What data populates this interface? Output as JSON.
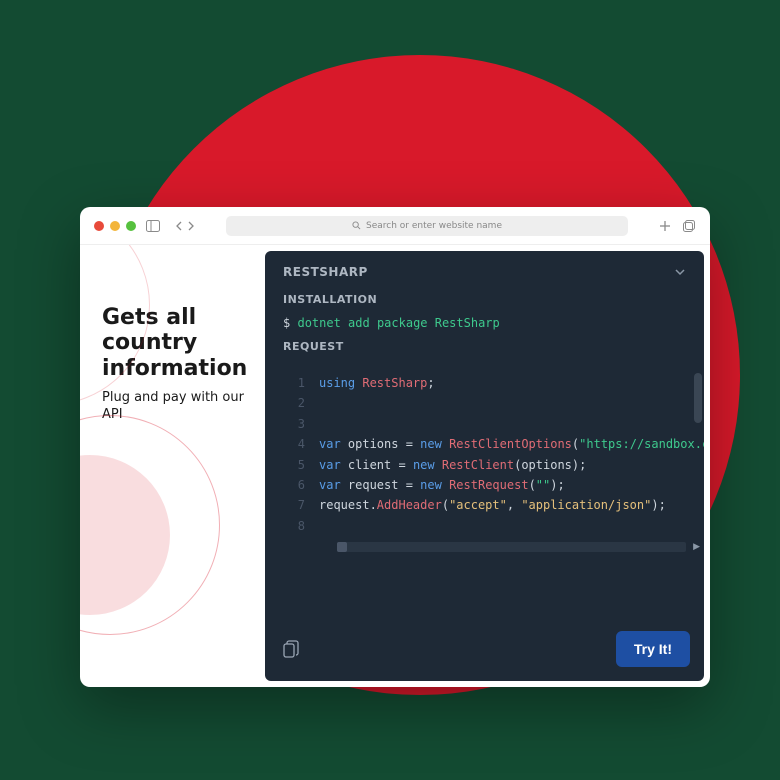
{
  "browser": {
    "urlbar_placeholder": "Search or enter website name"
  },
  "hero": {
    "title": "Gets all country information",
    "subtitle": "Plug and pay with our API"
  },
  "panel": {
    "title": "RESTSHARP",
    "installation_label": "INSTALLATION",
    "install_prompt": "$",
    "install_cmd": "dotnet add package RestSharp",
    "request_label": "REQUEST",
    "try_button": "Try It!"
  },
  "code": {
    "l1": {
      "num": "1",
      "kw": "using",
      "type": " RestSharp",
      "pn": ";"
    },
    "l2": {
      "num": "2"
    },
    "l3": {
      "num": "3"
    },
    "l4": {
      "num": "4",
      "kw": "var",
      "pn1": " options = ",
      "kw2": "new",
      "type": " RestClientOptions",
      "pn2": "(",
      "str": "\"https://sandbox.caxt"
    },
    "l5": {
      "num": "5",
      "kw": "var",
      "pn1": " client = ",
      "kw2": "new",
      "type": " RestClient",
      "pn2": "(options);"
    },
    "l6": {
      "num": "6",
      "kw": "var",
      "pn1": " request = ",
      "kw2": "new",
      "type": " RestRequest",
      "pn2": "(",
      "str": "\"\"",
      "pn3": ");"
    },
    "l7": {
      "num": "7",
      "pn1": "request.",
      "fn": "AddHeader",
      "pn2": "(",
      "str1": "\"accept\"",
      "pn3": ", ",
      "str2": "\"application/json\"",
      "pn4": ");"
    },
    "l8": {
      "num": "8"
    }
  }
}
